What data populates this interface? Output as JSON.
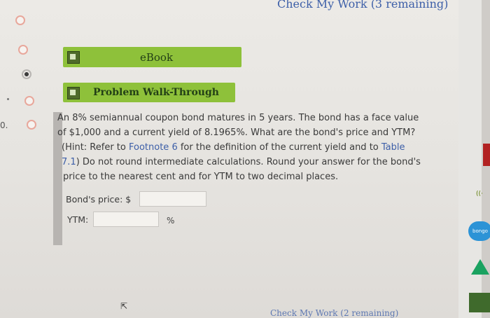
{
  "header": {
    "check_work": "Check My Work (3 remaining)"
  },
  "footer": {
    "check_work": "Check My Work (2 remaining)"
  },
  "side": {
    "number": "0."
  },
  "bars": {
    "ebook": "eBook",
    "walkthrough": "Problem Walk-Through"
  },
  "problem": {
    "l1": "An 8% semiannual coupon bond matures in 5 years. The bond has a face value",
    "l2": "of $1,000 and a current yield of 8.1965%. What are the bond's price and YTM?",
    "l3_pre": "(Hint: Refer to ",
    "l3_link1": "Footnote 6",
    "l3_mid": " for the definition of the current yield and to ",
    "l3_link2": "Table",
    "l4_link": "7.1",
    "l4_post": ") Do not round intermediate calculations. Round your answer for the bond's",
    "l5": "price to the nearest cent and for YTM to two decimal places."
  },
  "answers": {
    "price_label": "Bond's price: $",
    "ytm_label": "YTM:",
    "ytm_unit": "%",
    "price_value": "",
    "ytm_value": ""
  },
  "right": {
    "badge": "bongo",
    "audio": "((·"
  }
}
